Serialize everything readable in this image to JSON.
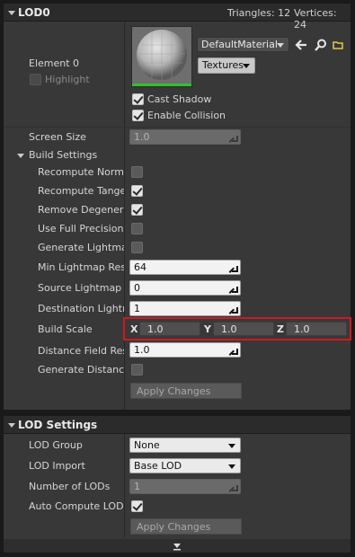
{
  "lod_panel": {
    "title": "LOD0",
    "triangles_label": "Triangles: 12",
    "vertices_label": "Vertices: 24"
  },
  "element": {
    "name": "Element 0",
    "highlight_label": "Highlight",
    "material_name": "DefaultMaterial",
    "textures_label": "Textures",
    "cast_shadow_label": "Cast Shadow",
    "enable_collision_label": "Enable Collision"
  },
  "screen_size": {
    "label": "Screen Size",
    "value": "1.0"
  },
  "build_settings": {
    "label": "Build Settings",
    "recompute_normals": {
      "label": "Recompute Normal",
      "checked": false
    },
    "recompute_tangents": {
      "label": "Recompute Tangen",
      "checked": true
    },
    "remove_degenerates": {
      "label": "Remove Degenerat",
      "checked": true
    },
    "full_precision_uvs": {
      "label": "Use Full Precision U",
      "checked": false
    },
    "generate_lightmap_uvs": {
      "label": "Generate Lightmap",
      "checked": false
    },
    "min_lightmap_resolution": {
      "label": "Min Lightmap Reso",
      "value": "64"
    },
    "source_lightmap_index": {
      "label": "Source Lightmap In",
      "value": "0"
    },
    "destination_lightmap_index": {
      "label": "Destination Lightm",
      "value": "1"
    },
    "build_scale": {
      "label": "Build Scale",
      "x_axis": "X",
      "x": "1.0",
      "y_axis": "Y",
      "y": "1.0",
      "z_axis": "Z",
      "z": "1.0"
    },
    "distance_field_resolution": {
      "label": "Distance Field Reso",
      "value": "1.0"
    },
    "generate_distance_field": {
      "label": "Generate Distance",
      "checked": false
    },
    "apply_label": "Apply Changes"
  },
  "lod_settings": {
    "title": "LOD Settings",
    "lod_group": {
      "label": "LOD Group",
      "value": "None"
    },
    "lod_import": {
      "label": "LOD Import",
      "value": "Base LOD"
    },
    "number_of_lods": {
      "label": "Number of LODs",
      "value": "1"
    },
    "auto_compute_lod": {
      "label": "Auto Compute LOD D",
      "checked": true
    },
    "apply_label": "Apply Changes"
  },
  "colors": {
    "panel": "#383838",
    "header": "#2b2b2b",
    "highlight_outline": "#d0191e",
    "thumbnail_underline": "#2fc32f",
    "browse_icon": "#e6c84a"
  }
}
